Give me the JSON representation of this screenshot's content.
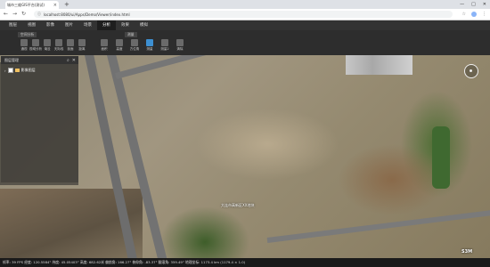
{
  "browser": {
    "tab_title": "城市三维GIS平台(测试)",
    "url": "localhost:8080/ui/Apps/Demo/Viewer/index.html",
    "new_tab": "+",
    "controls": {
      "minimize": "—",
      "maximize": "□",
      "close": "✕"
    }
  },
  "menubar": {
    "items": [
      "图层",
      "视图",
      "影像",
      "图片",
      "场景",
      "分析",
      "效果",
      "模拟"
    ],
    "active_index": 5
  },
  "ribbon": {
    "groups": [
      "空间分析",
      "测量"
    ],
    "buttons": [
      "通视",
      "视域分析",
      "淹没",
      "天际线",
      "剖面",
      "距离",
      "面积",
      "高度",
      "方位角",
      "测量",
      "测量2",
      "清除"
    ],
    "blue_index": 9
  },
  "layer_panel": {
    "title": "图层管理",
    "tools": [
      "⌕",
      "✕"
    ],
    "item_label": "影像图层"
  },
  "map": {
    "label": "大连市高新区XX地块"
  },
  "statusbar": {
    "text": "帧率: 39 FPS  经度: 120.5584°  纬度: 45.05403°  高度: 682.62米  偏航角: 166.27°  俯仰角: -83.37°  翻滚角: 359.49°  地理坐标: 1173.4 km (1179.4 × 1.0)"
  },
  "logo": "S3M"
}
